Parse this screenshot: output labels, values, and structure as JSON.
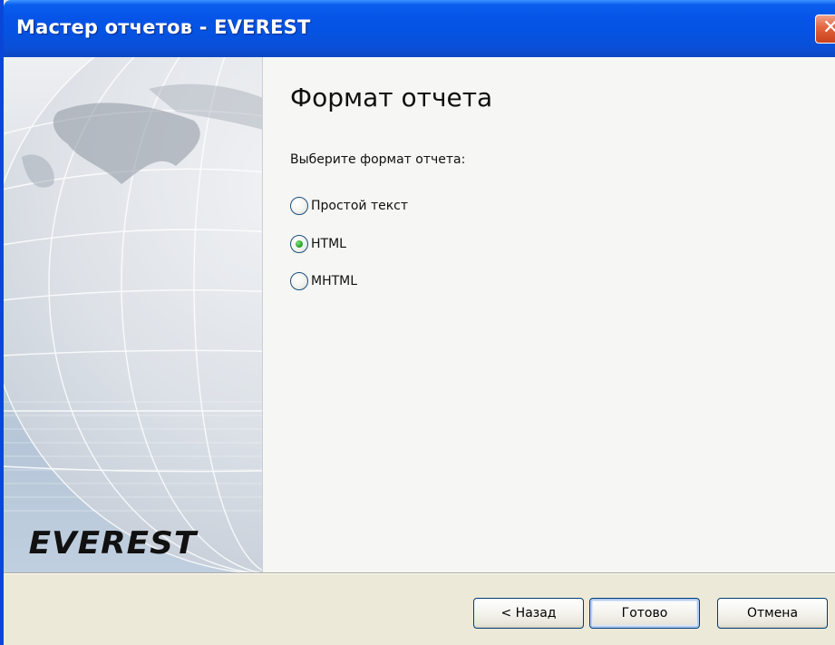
{
  "window": {
    "title": "Мастер отчетов - EVEREST",
    "close_glyph": "✕"
  },
  "banner": {
    "logo_text": "EVEREST"
  },
  "page": {
    "title": "Формат отчета",
    "prompt": "Выберите формат отчета:",
    "options": [
      {
        "label": "Простой текст",
        "selected": false
      },
      {
        "label": "HTML",
        "selected": true
      },
      {
        "label": "MHTML",
        "selected": false
      }
    ]
  },
  "buttons": {
    "back": "< Назад",
    "finish": "Готово",
    "cancel": "Отмена"
  },
  "colors": {
    "titlebar": "#0554e3",
    "radio_dot": "#2ea52e",
    "button_border": "#003c74"
  }
}
